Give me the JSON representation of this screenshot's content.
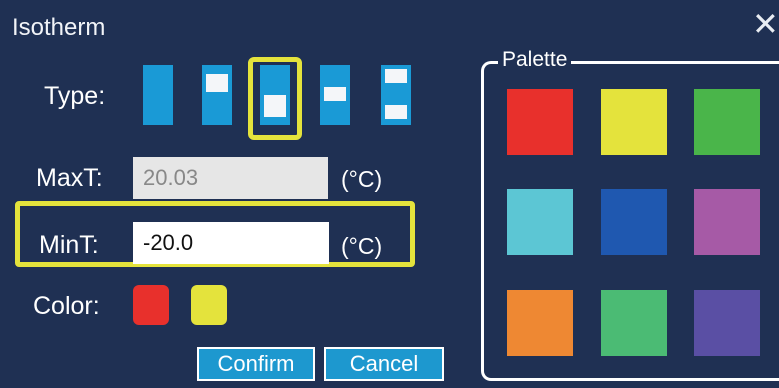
{
  "dialog": {
    "title": "Isotherm",
    "close_icon": "close-icon",
    "close_glyph": "✕"
  },
  "type": {
    "label": "Type:",
    "options": [
      "full",
      "upper-block",
      "lower-block",
      "middle-block",
      "split-blocks"
    ],
    "selected": "lower-block",
    "highlight_color": "#e4e33c",
    "button_color": "#1a9ad6"
  },
  "maxt": {
    "label": "MaxT:",
    "value": "20.03",
    "unit": "(°C)",
    "editable": false
  },
  "mint": {
    "label": "MinT:",
    "value": "-20.0",
    "unit": "(°C)",
    "editable": true
  },
  "color": {
    "label": "Color:",
    "selected": [
      "#e8302c",
      "#e4e33c"
    ]
  },
  "buttons": {
    "confirm_label": "Confirm",
    "cancel_label": "Cancel"
  },
  "palette": {
    "label": "Palette",
    "swatches": [
      "#e8302c",
      "#e4e33c",
      "#4ab54a",
      "#5cc6d4",
      "#1f58b0",
      "#a65aa6",
      "#ee8833",
      "#4bbb74",
      "#5a4fa4"
    ]
  }
}
